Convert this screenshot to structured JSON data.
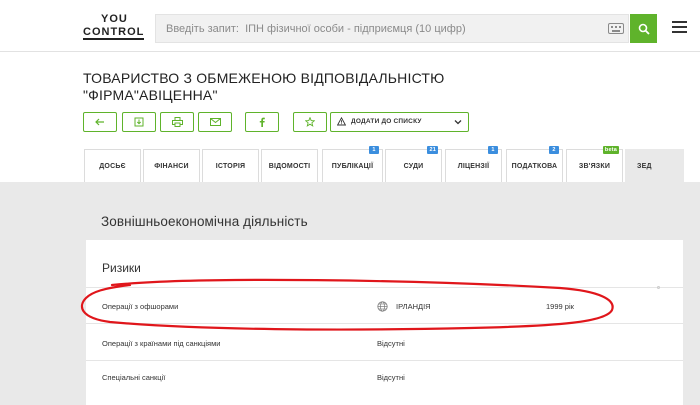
{
  "header": {
    "logo_line1": "YOU",
    "logo_line2": "CONTROL",
    "search_placeholder": "Введіть запит:  ІПН фізичної особи - підприємця (10 цифр)"
  },
  "company": {
    "name_line1": "ТОВАРИСТВО З ОБМЕЖЕНОЮ ВІДПОВІДАЛЬНІСТЮ",
    "name_line2": "\"ФІРМА\"АВІЦЕННА\""
  },
  "actions": {
    "add_to_list_label": "ДОДАТИ ДО СПИСКУ",
    "icons": [
      "arrow-left-icon",
      "download-icon",
      "print-icon",
      "mail-icon",
      "facebook-icon",
      "star-icon"
    ]
  },
  "tabs": [
    {
      "label": "ДОСЬЄ",
      "badge": ""
    },
    {
      "label": "ФІНАНСИ",
      "badge": ""
    },
    {
      "label": "ІСТОРІЯ",
      "badge": ""
    },
    {
      "label": "ВІДОМОСТІ",
      "badge": ""
    },
    {
      "label": "ПУБЛІКАЦІЇ",
      "badge": "1"
    },
    {
      "label": "СУДИ",
      "badge": "21"
    },
    {
      "label": "ЛІЦЕНЗІЇ",
      "badge": "1"
    },
    {
      "label": "ПОДАТКОВА",
      "badge": "2"
    },
    {
      "label": "ЗВ'ЯЗКИ",
      "badge": "beta"
    },
    {
      "label": "ЗЕД",
      "badge": ""
    }
  ],
  "main": {
    "section_title": "Зовнішньоекономічна діяльність",
    "panel_title": "Ризики",
    "rows": [
      {
        "label": "Операції з офшорами",
        "value": "ІРЛАНДІЯ",
        "year": "1999 рік"
      },
      {
        "label": "Операції з країнами під санкціями",
        "value": "Відсутні"
      },
      {
        "label": "Спеціальні санкції",
        "value": "Відсутні"
      }
    ]
  },
  "colors": {
    "accent_green": "#5fb32b",
    "badge_blue": "#3b8ede",
    "annotation_red": "#e0161b"
  }
}
